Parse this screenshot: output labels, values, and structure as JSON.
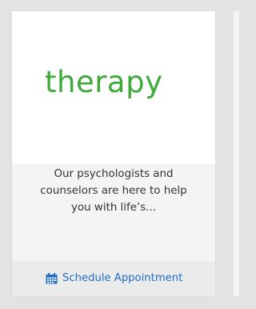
{
  "card": {
    "logo_text": "therapy",
    "description_lines": [
      "Our psychologists and",
      "counselors are here to help",
      "you with life’s..."
    ],
    "action_label": "Schedule Appointment",
    "action_icon": "calendar-icon"
  },
  "colors": {
    "logo": "#3faa3b",
    "link": "#1f6ec6",
    "page_bg": "#e3e3e3",
    "card_bg": "#f4f4f4",
    "footer_bg": "#ebebeb"
  }
}
